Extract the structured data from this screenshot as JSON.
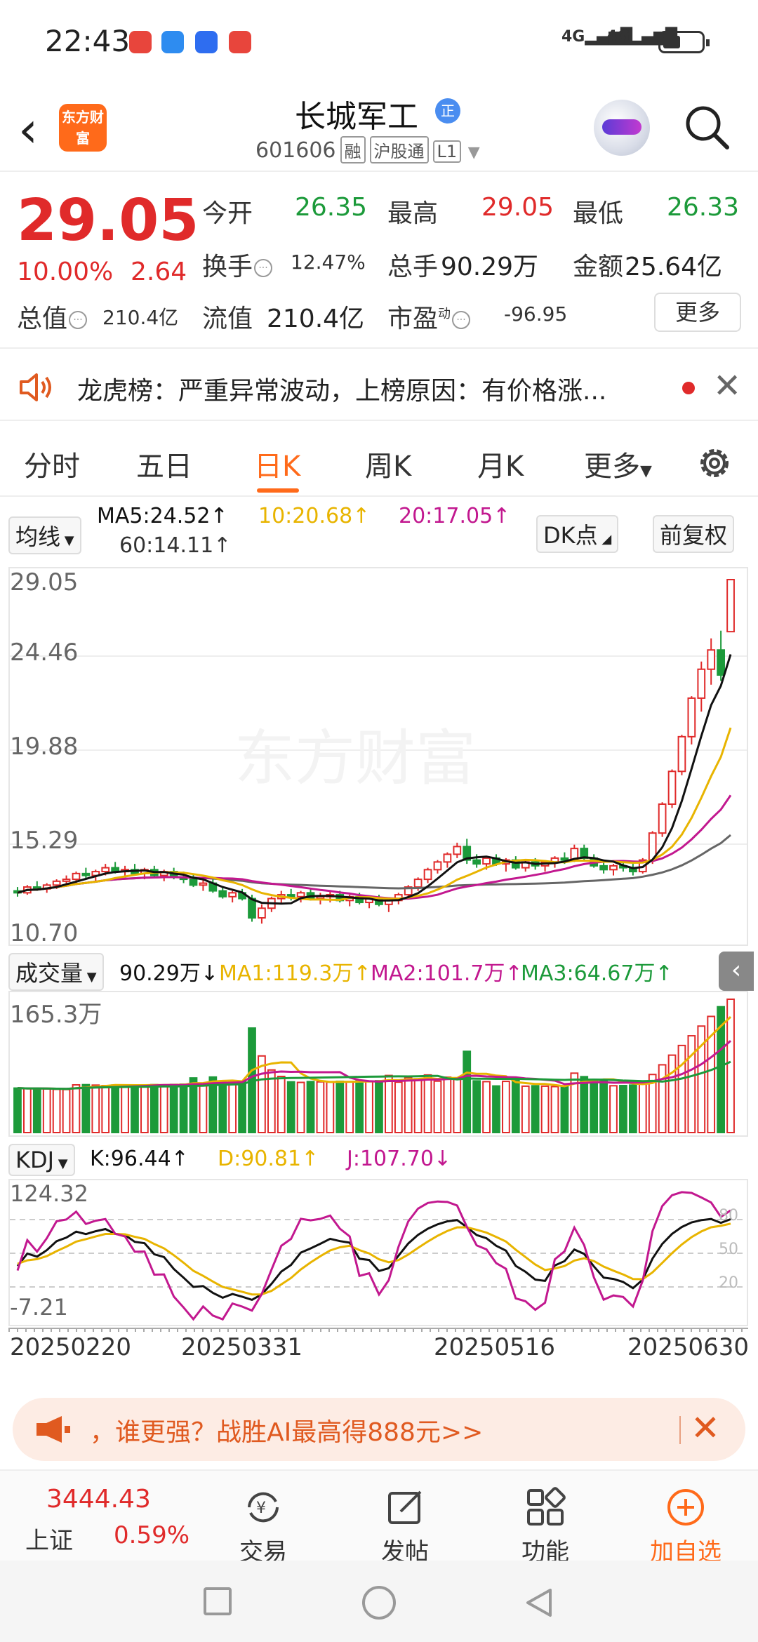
{
  "status_bar": {
    "time": "22:43",
    "network1": "4G",
    "network2": "4G"
  },
  "header": {
    "logo_text": "东方财富",
    "stock_name": "长城军工",
    "badge": "正",
    "stock_code": "601606",
    "tags": [
      "融",
      "沪股通",
      "L1"
    ]
  },
  "quote": {
    "price": "29.05",
    "change_pct": "10.00%",
    "change": "2.64",
    "open_label": "今开",
    "open": "26.35",
    "high_label": "最高",
    "high": "29.05",
    "low_label": "最低",
    "low": "26.33",
    "turnover_label": "换手",
    "turnover": "12.47%",
    "volume_label": "总手",
    "volume": "90.29万",
    "amount_label": "金额",
    "amount": "25.64亿",
    "mktcap_label": "总值",
    "mktcap": "210.4亿",
    "float_label": "流值",
    "float": "210.4亿",
    "pe_label": "市盈",
    "pe_sup": "动",
    "pe": "-96.95",
    "more": "更多"
  },
  "notice": {
    "text": "龙虎榜：严重异常波动，上榜原因：有价格涨..."
  },
  "tabs": [
    "分时",
    "五日",
    "日K",
    "周K",
    "月K",
    "更多"
  ],
  "active_tab": "日K",
  "ma": {
    "selector": "均线",
    "ma5": "MA5:24.52↑",
    "ma10": "10:20.68↑",
    "ma20": "20:17.05↑",
    "ma60": "60:14.11↑",
    "dk": "DK点",
    "adjust": "前复权"
  },
  "kline_axis": [
    "29.05",
    "24.46",
    "19.88",
    "15.29",
    "10.70"
  ],
  "volume": {
    "selector": "成交量",
    "value": "90.29万↓",
    "ma1": "MA1:119.3万↑",
    "ma2": "MA2:101.7万↑",
    "ma3": "MA3:64.67万↑",
    "axis_max": "165.3万"
  },
  "kdj": {
    "selector": "KDJ",
    "k": "K:96.44↑",
    "d": "D:90.81↑",
    "j": "J:107.70↓",
    "axis_max": "124.32",
    "axis_min": "-7.21",
    "levels": [
      "80",
      "50",
      "20"
    ]
  },
  "dates": [
    "20250220",
    "20250331",
    "20250516",
    "20250630"
  ],
  "banner": {
    "text": "，谁更强？战胜AI最高得888元>>"
  },
  "bottom": {
    "index_value": "3444.43",
    "index_name": "上证",
    "index_pct": "0.59%",
    "nav": [
      "交易",
      "发帖",
      "功能",
      "加自选"
    ]
  },
  "colors": {
    "up": "#e02a2a",
    "down": "#1c9a3a",
    "accent": "#ff6a1a",
    "ma5": "#111111",
    "ma10": "#e8b400",
    "ma20": "#c2188f",
    "ma60": "#666666"
  },
  "chart_data": {
    "type": "candlestick",
    "ylim": [
      10.7,
      29.05
    ],
    "candles": [
      [
        12.9,
        13.1,
        12.6,
        12.8
      ],
      [
        12.8,
        13.2,
        12.7,
        13.1
      ],
      [
        13.1,
        13.4,
        12.9,
        13.0
      ],
      [
        13.0,
        13.3,
        12.8,
        13.2
      ],
      [
        13.2,
        13.5,
        13.0,
        13.4
      ],
      [
        13.4,
        13.7,
        13.2,
        13.5
      ],
      [
        13.5,
        13.9,
        13.3,
        13.8
      ],
      [
        13.8,
        14.1,
        13.5,
        13.7
      ],
      [
        13.7,
        14.0,
        13.4,
        13.9
      ],
      [
        13.9,
        14.3,
        13.7,
        14.1
      ],
      [
        14.1,
        14.4,
        13.8,
        13.9
      ],
      [
        13.9,
        14.2,
        13.6,
        14.0
      ],
      [
        14.0,
        14.3,
        13.7,
        13.8
      ],
      [
        13.8,
        14.1,
        13.5,
        14.0
      ],
      [
        14.0,
        14.2,
        13.6,
        13.7
      ],
      [
        13.7,
        14.0,
        13.4,
        13.9
      ],
      [
        13.9,
        14.1,
        13.5,
        13.6
      ],
      [
        13.6,
        13.9,
        13.3,
        13.5
      ],
      [
        13.5,
        13.8,
        13.1,
        13.2
      ],
      [
        13.2,
        13.5,
        12.9,
        13.3
      ],
      [
        13.3,
        13.5,
        12.8,
        12.9
      ],
      [
        12.9,
        13.1,
        12.5,
        12.6
      ],
      [
        12.6,
        12.9,
        12.3,
        12.8
      ],
      [
        12.8,
        13.0,
        12.4,
        12.5
      ],
      [
        12.5,
        12.7,
        11.3,
        11.5
      ],
      [
        11.5,
        12.2,
        11.2,
        12.0
      ],
      [
        12.0,
        12.6,
        11.8,
        12.5
      ],
      [
        12.5,
        12.9,
        12.2,
        12.7
      ],
      [
        12.7,
        13.0,
        12.4,
        12.6
      ],
      [
        12.6,
        12.9,
        12.3,
        12.8
      ],
      [
        12.8,
        13.0,
        12.4,
        12.5
      ],
      [
        12.5,
        12.8,
        12.2,
        12.6
      ],
      [
        12.6,
        12.9,
        12.3,
        12.7
      ],
      [
        12.7,
        12.9,
        12.3,
        12.4
      ],
      [
        12.4,
        12.7,
        12.1,
        12.6
      ],
      [
        12.6,
        12.8,
        12.2,
        12.3
      ],
      [
        12.3,
        12.6,
        12.0,
        12.5
      ],
      [
        12.5,
        12.7,
        12.1,
        12.2
      ],
      [
        12.2,
        12.5,
        11.8,
        12.4
      ],
      [
        12.4,
        12.8,
        12.2,
        12.7
      ],
      [
        12.7,
        13.2,
        12.5,
        13.1
      ],
      [
        13.1,
        13.6,
        12.9,
        13.5
      ],
      [
        13.5,
        14.1,
        13.3,
        14.0
      ],
      [
        14.0,
        14.5,
        13.8,
        14.4
      ],
      [
        14.4,
        14.9,
        14.1,
        14.8
      ],
      [
        14.8,
        15.4,
        14.6,
        15.2
      ],
      [
        15.2,
        15.6,
        14.3,
        14.5
      ],
      [
        14.5,
        14.8,
        14.1,
        14.3
      ],
      [
        14.3,
        14.7,
        14.0,
        14.6
      ],
      [
        14.6,
        14.8,
        14.2,
        14.3
      ],
      [
        14.3,
        14.6,
        13.9,
        14.5
      ],
      [
        14.5,
        14.7,
        14.0,
        14.1
      ],
      [
        14.1,
        14.5,
        13.9,
        14.4
      ],
      [
        14.4,
        14.6,
        14.0,
        14.2
      ],
      [
        14.2,
        14.5,
        13.9,
        14.4
      ],
      [
        14.4,
        14.7,
        14.1,
        14.6
      ],
      [
        14.6,
        14.9,
        14.3,
        14.5
      ],
      [
        14.5,
        15.3,
        14.4,
        15.1
      ],
      [
        15.1,
        15.3,
        14.5,
        14.6
      ],
      [
        14.6,
        14.8,
        14.1,
        14.2
      ],
      [
        14.2,
        14.5,
        13.8,
        14.0
      ],
      [
        14.0,
        14.3,
        13.7,
        14.2
      ],
      [
        14.2,
        14.5,
        13.9,
        14.1
      ],
      [
        14.1,
        14.3,
        13.7,
        13.9
      ],
      [
        13.9,
        14.6,
        13.8,
        14.5
      ],
      [
        14.5,
        16.0,
        14.3,
        15.9
      ],
      [
        15.9,
        17.5,
        15.7,
        17.4
      ],
      [
        17.4,
        19.2,
        17.2,
        19.1
      ],
      [
        19.1,
        21.0,
        18.9,
        20.9
      ],
      [
        20.9,
        23.0,
        20.5,
        22.9
      ],
      [
        22.9,
        24.8,
        22.2,
        24.4
      ],
      [
        24.4,
        26.0,
        23.6,
        25.4
      ],
      [
        25.4,
        26.4,
        23.8,
        24.1
      ],
      [
        26.35,
        29.05,
        26.33,
        29.05
      ]
    ],
    "volume_max": 165.3,
    "kdj_range": [
      -7.21,
      124.32
    ]
  }
}
